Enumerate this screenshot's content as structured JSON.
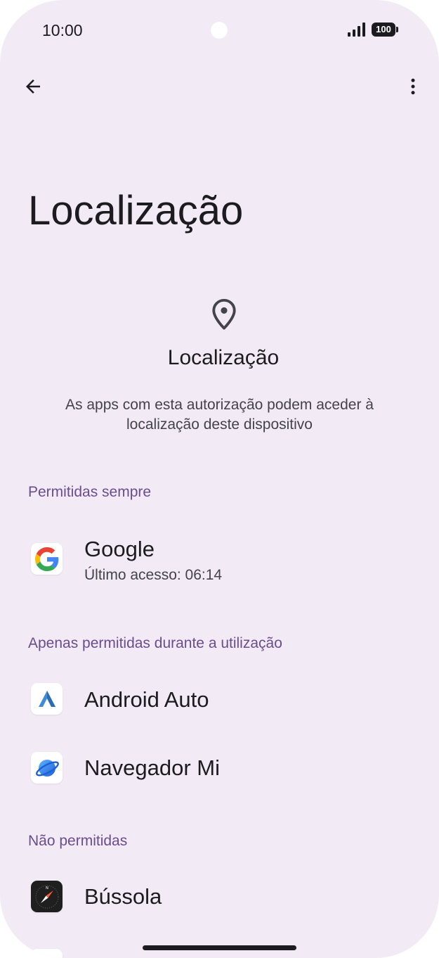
{
  "status_bar": {
    "time": "10:00",
    "battery": "100",
    "signal_icon": "signal-icon",
    "battery_icon": "battery-icon"
  },
  "toolbar": {
    "back_icon": "arrow-back-icon",
    "more_icon": "more-vert-icon"
  },
  "page": {
    "title": "Localização"
  },
  "header": {
    "icon": "location-pin-icon",
    "title": "Localização",
    "description": "As apps com esta autorização podem aceder à localização deste dispositivo"
  },
  "sections": [
    {
      "title": "Permitidas sempre",
      "apps": [
        {
          "name": "Google",
          "subtitle": "Último acesso: 06:14",
          "icon": "google-icon"
        }
      ]
    },
    {
      "title": "Apenas permitidas durante a utilização",
      "apps": [
        {
          "name": "Android Auto",
          "icon": "android-auto-icon"
        },
        {
          "name": "Navegador Mi",
          "icon": "mi-browser-icon"
        }
      ]
    },
    {
      "title": "Não permitidas",
      "apps": [
        {
          "name": "Bússola",
          "icon": "compass-icon"
        }
      ]
    }
  ],
  "colors": {
    "background": "#f2eaf4",
    "section_header": "#6b4d8e",
    "text_primary": "#1c1b1f",
    "text_secondary": "#45434a"
  }
}
